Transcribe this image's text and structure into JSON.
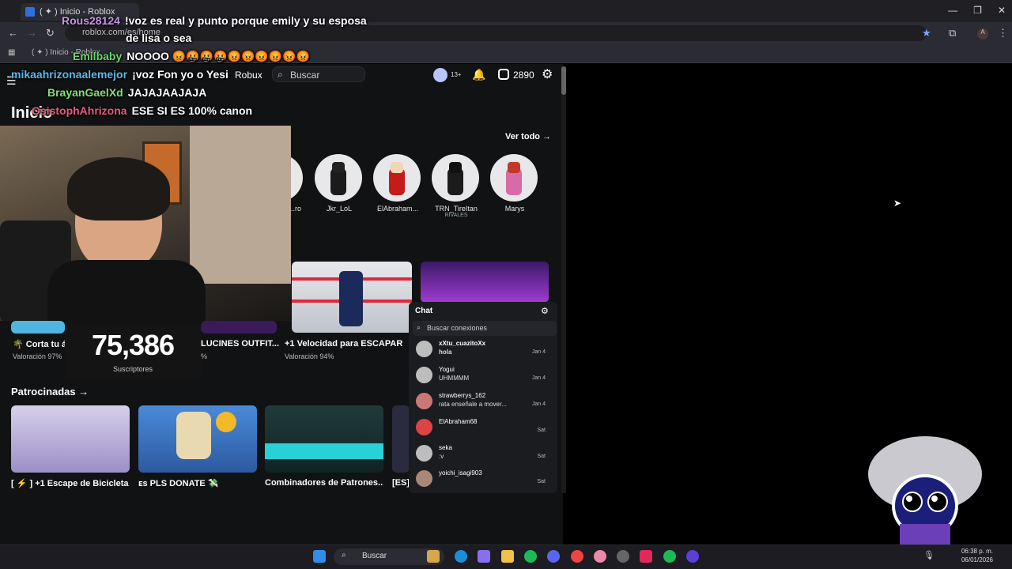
{
  "browser": {
    "tab_title": "( ✦ ) Inicio - Roblox",
    "url": "roblox.com/es/home",
    "bookmarks": [
      "( ✦ ) Inicio - Roblox"
    ]
  },
  "roblox": {
    "nav": {
      "robux": "Robux",
      "search_placeholder": "Buscar",
      "age_badge": "13+",
      "robux_count": "2890"
    },
    "page_title": "Inicio",
    "friends": {
      "view_all": "Ver todo →",
      "items": [
        {
          "name": "...ro",
          "sub": ""
        },
        {
          "name": "Jkr_LoL",
          "sub": ""
        },
        {
          "name": "ElAbraham...",
          "sub": ""
        },
        {
          "name": "TRN_TireItan",
          "sub": "RIVALES"
        },
        {
          "name": "Marys",
          "sub": ""
        }
      ]
    },
    "games_row": [
      {
        "title": "🌴 Corta tu á",
        "rating": "Valoración 97%"
      },
      {
        "title": "LUCINES OUTFIT...",
        "rating": "%"
      },
      {
        "title": "+1 Velocidad para ESCAPAR",
        "rating": "Valoración 94%"
      }
    ],
    "sponsored": {
      "title": "Patrocinadas →",
      "items": [
        {
          "title": "[ ⚡ ] +1 Escape de Bicicleta ..."
        },
        {
          "title": "ᴇs PLS DONATE 💸"
        },
        {
          "title": "Combinadores de Patrones..."
        },
        {
          "title": "[ES]"
        }
      ]
    },
    "chat": {
      "title": "Chat",
      "search_placeholder": "Buscar conexiones",
      "rows": [
        {
          "name": "xXtu_cuazitoXx",
          "msg": "hola",
          "date": "Jan 4"
        },
        {
          "name": "Yogui",
          "msg": "UHMMMM",
          "date": "Jan 4"
        },
        {
          "name": "strawberrys_162",
          "msg": "rata enseñale a mover...",
          "date": "Jan 4"
        },
        {
          "name": "ElAbraham68",
          "msg": "",
          "date": "Sat"
        },
        {
          "name": "seka",
          "msg": ":v",
          "date": "Sat"
        },
        {
          "name": "yoichi_isagi903",
          "msg": "",
          "date": "Sat"
        }
      ]
    }
  },
  "overlay": {
    "subscriber_count": "75,386",
    "subscriber_label": "Suscriptores",
    "chat_messages": [
      {
        "user": "Rous28124",
        "color": "#c994e8",
        "text": "!voz es real y punto porque emily y su esposa"
      },
      {
        "user": "",
        "color": "#ffffff",
        "text": "de lisa o sea"
      },
      {
        "user": "Emilbaby",
        "color": "#6ad86a",
        "text": "NOOOO 😡🤬🤬🤬😡😡😡😡😡😡"
      },
      {
        "user": "mikaahrizonaalemejor",
        "color": "#5fb9e8",
        "text": "¡voz Fon yo o Yesi"
      },
      {
        "user": "BrayanGaelXd",
        "color": "#7fe36f",
        "text": "JAJAJAAJAJA"
      },
      {
        "user": "OsistophAhrizona",
        "color": "#e85c7a",
        "text": "ESE SI ES 100% canon"
      }
    ]
  },
  "taskbar": {
    "search": "Buscar",
    "time": "06:38 p. m.",
    "date": "06/01/2026"
  }
}
